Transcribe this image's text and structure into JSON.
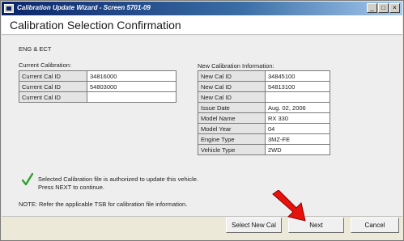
{
  "window": {
    "title": "Calibration Update Wizard - Screen 5701-09",
    "minimize": "_",
    "maximize": "□",
    "close": "×"
  },
  "heading": "Calibration Selection Confirmation",
  "system": "ENG & ECT",
  "current": {
    "label": "Current Calibration:",
    "rows": [
      {
        "key": "Current Cal ID",
        "value": "34816000"
      },
      {
        "key": "Current Cal ID",
        "value": "54803000"
      },
      {
        "key": "Current Cal ID",
        "value": ""
      }
    ]
  },
  "new": {
    "label": "New Calibration Information:",
    "rows": [
      {
        "key": "New Cal ID",
        "value": "34845100"
      },
      {
        "key": "New Cal ID",
        "value": "54813100"
      },
      {
        "key": "New Cal ID",
        "value": ""
      },
      {
        "key": "Issue Date",
        "value": "Aug. 02, 2006"
      },
      {
        "key": "Model Name",
        "value": "RX 330"
      },
      {
        "key": "Model Year",
        "value": "04"
      },
      {
        "key": "Engine Type",
        "value": "3MZ-FE"
      },
      {
        "key": "Vehicle Type",
        "value": "2WD"
      }
    ]
  },
  "message": {
    "line1": "Selected Calibration file is authorized to update this vehicle.",
    "line2": "Press NEXT to continue."
  },
  "note": "NOTE: Refer the applicable TSB for calibration file information.",
  "buttons": {
    "select": "Select New Cal",
    "next": "Next",
    "cancel": "Cancel"
  },
  "colors": {
    "check": "#2ea02e",
    "arrow": "#e8120c"
  }
}
